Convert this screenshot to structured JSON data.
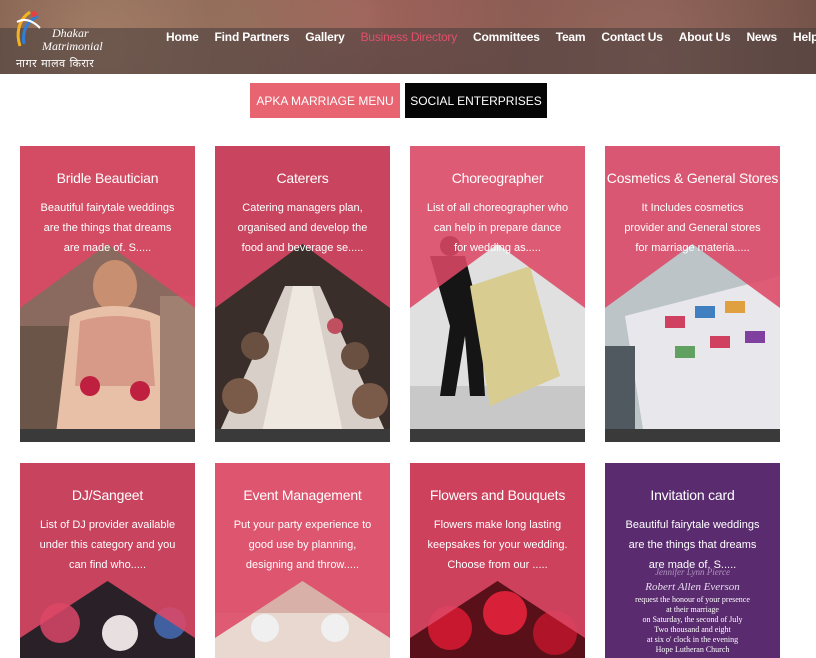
{
  "logo": {
    "name_line1": "Dhakar",
    "name_line2": "Matrimonial",
    "tagline": "नागर मालव किरार"
  },
  "nav": {
    "items": [
      "Home",
      "Find Partners",
      "Gallery",
      "Business Directory",
      "Committees",
      "Team",
      "Contact Us",
      "About Us",
      "News",
      "Help"
    ],
    "active": "Business Directory",
    "help_caret": "▾",
    "active_color": "#e0506a"
  },
  "tabs": {
    "marriage_label": "APKA MARRIAGE MENU",
    "social_label": "SOCIAL ENTERPRISES"
  },
  "colors": {
    "accent": "#e86470",
    "card_overlay": "#dd4865",
    "dark_button": "#050505"
  },
  "cards": [
    {
      "title": "Bridle Beautician",
      "desc": "Beautiful fairytale weddings are the things that dreams are made of. S.....",
      "image": "bride-photo"
    },
    {
      "title": "Caterers",
      "desc": "Catering managers plan, organised and develop the food and beverage se.....",
      "image": "banquet-table-photo"
    },
    {
      "title": "Choreographer",
      "desc": "List of all choreographer who can help in prepare dance for wedding as.....",
      "image": "dancing-couple-photo"
    },
    {
      "title": "Cosmetics & General Stores",
      "desc": "It Includes cosmetics provider and General stores for marriage materia.....",
      "image": "store-shelves-photo"
    },
    {
      "title": "DJ/Sangeet",
      "desc": "List of DJ provider available under this category and you can find who.....",
      "image": "dj-party-photo"
    },
    {
      "title": "Event Management",
      "desc": "Put your party experience to good use by planning, designing and throw.....",
      "image": "event-hall-photo"
    },
    {
      "title": "Flowers and Bouquets",
      "desc": "Flowers make long lasting keepsakes for your wedding. Choose from our .....",
      "image": "roses-photo"
    },
    {
      "title": "Invitation card",
      "desc": "Beautiful fairytale weddings are the things that dreams are made of. S.....",
      "image": "invitation-card-photo"
    }
  ],
  "invitation_text": {
    "names1": "Jennifer Lynn Pierce",
    "names2": "Robert Allen Everson",
    "lines": [
      "request the honour of your presence",
      "at their marriage",
      "on Saturday, the second of July",
      "Two thousand and eight",
      "at six o' clock in the evening",
      "Hope Lutheran Church"
    ]
  }
}
